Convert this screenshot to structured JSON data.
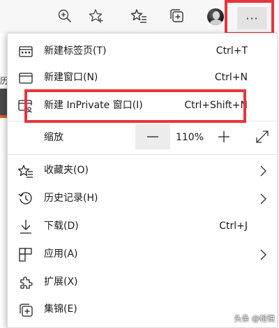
{
  "toolbar": {
    "zoom_icon": "magnifier-plus-icon",
    "favorite_icon": "star-add-icon",
    "favorites_icon": "favorites-list-icon",
    "collections_icon": "collections-icon",
    "more_icon": "more-ellipsis-icon",
    "more_label": "···"
  },
  "page": {
    "tab_char": "历"
  },
  "menu": {
    "items": [
      {
        "label": "新建标签页(T)",
        "shortcut": "Ctrl+T",
        "icon": "new-tab-icon"
      },
      {
        "label": "新建窗口(N)",
        "shortcut": "Ctrl+N",
        "icon": "new-window-icon"
      },
      {
        "label": "新建 InPrivate 窗口(I)",
        "shortcut": "Ctrl+Shift+N",
        "icon": "inprivate-window-icon"
      }
    ],
    "zoom": {
      "label": "缩放",
      "minus": "—",
      "value": "110%",
      "plus": "+",
      "fullscreen_icon": "fullscreen-icon"
    },
    "items2": [
      {
        "label": "收藏夹(O)",
        "icon": "favorites-icon",
        "has_submenu": true
      },
      {
        "label": "历史记录(H)",
        "icon": "history-icon",
        "has_submenu": true
      },
      {
        "label": "下载(D)",
        "shortcut": "Ctrl+J",
        "icon": "download-icon"
      },
      {
        "label": "应用(A)",
        "icon": "apps-icon",
        "has_submenu": true
      },
      {
        "label": "扩展(X)",
        "icon": "extensions-icon"
      },
      {
        "label": "集锦(E)",
        "icon": "collections-icon"
      }
    ]
  },
  "watermark": "头条 @枪锐",
  "colors": {
    "highlight": "#e8343c",
    "toolbar_bg": "#f7f7f7",
    "orange_accent": "#e25c1c"
  }
}
